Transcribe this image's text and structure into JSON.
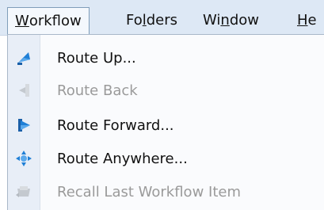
{
  "menubar": {
    "items": [
      {
        "label": "Workflow",
        "mnemonic": "W",
        "rest": "orkflow"
      },
      {
        "label": "Folders",
        "pre": "Fo",
        "mnemonic": "l",
        "rest": "ders"
      },
      {
        "label": "Window",
        "pre": "Wi",
        "mnemonic": "n",
        "rest": "dow"
      },
      {
        "label": "He",
        "pre": "",
        "mnemonic": "H",
        "rest": "e"
      }
    ]
  },
  "dropdown": {
    "items": [
      {
        "label": "Route Up...",
        "enabled": true,
        "icon": "route-up-icon"
      },
      {
        "label": "Route Back",
        "enabled": false,
        "icon": "route-back-icon"
      },
      {
        "label": "Route Forward...",
        "enabled": true,
        "icon": "route-forward-icon"
      },
      {
        "label": "Route Anywhere...",
        "enabled": true,
        "icon": "route-anywhere-icon"
      },
      {
        "label": "Recall Last Workflow Item",
        "enabled": false,
        "icon": "recall-icon"
      }
    ]
  },
  "colors": {
    "menubar_bg": "#dde8f5",
    "icon_blue": "#1f7fd6",
    "disabled_text": "#9a9a9a"
  }
}
